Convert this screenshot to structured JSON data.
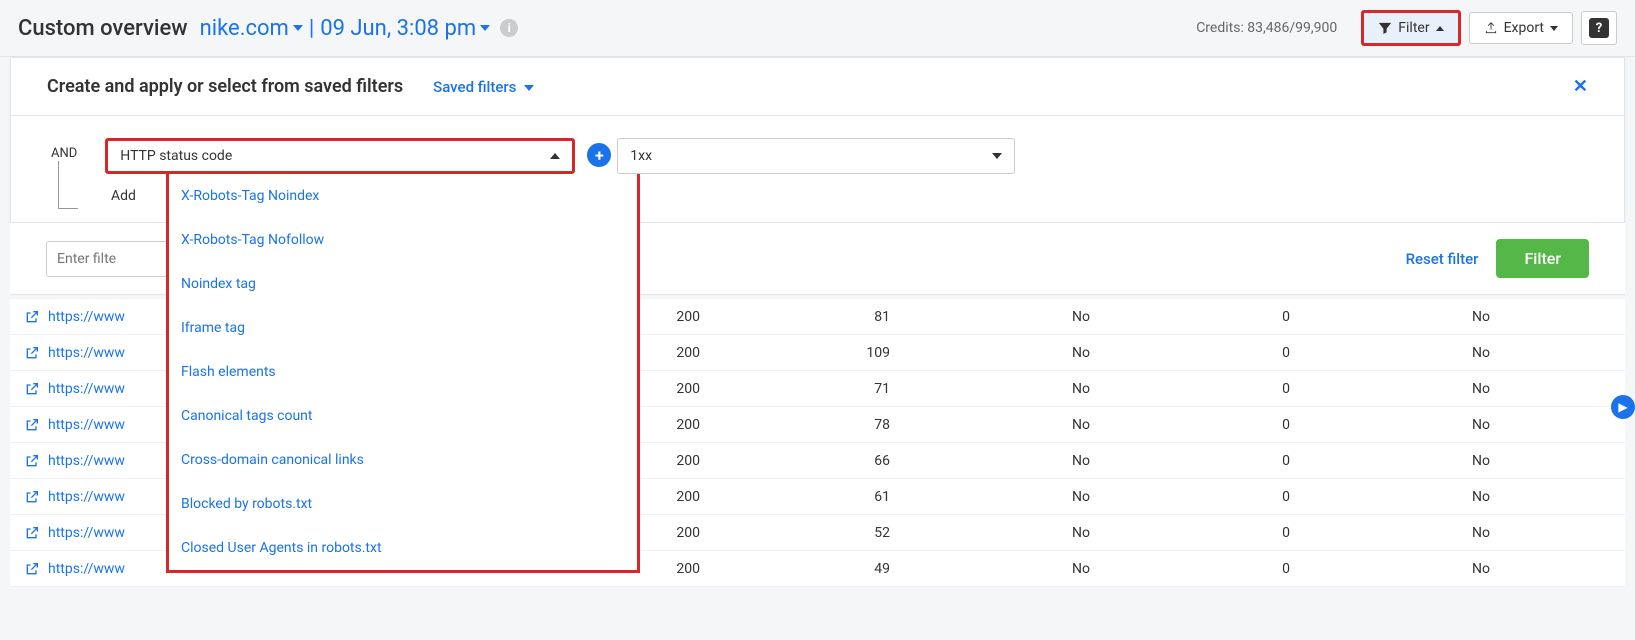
{
  "header": {
    "title": "Custom overview",
    "site": "nike.com",
    "date": "09 Jun, 3:08 pm",
    "credits": "Credits: 83,486/99,900",
    "filter_label": "Filter",
    "export_label": "Export",
    "help": "?"
  },
  "panel": {
    "title": "Create and apply or select from saved filters",
    "saved": "Saved filters",
    "and": "AND",
    "condition_value": "HTTP status code",
    "value_selected": "1xx",
    "add_group": "Add",
    "reset": "Reset filter",
    "apply": "Filter",
    "input_placeholder": "Enter filte"
  },
  "dropdown": {
    "items": [
      "X-Robots-Tag Noindex",
      "X-Robots-Tag Nofollow",
      "Noindex tag",
      "Iframe tag",
      "Flash elements",
      "Canonical tags count",
      "Cross-domain canonical links",
      "Blocked by robots.txt",
      "Closed User Agents in robots.txt"
    ]
  },
  "rows": [
    {
      "url": "https://www",
      "status": "200",
      "v": "81",
      "a": "No",
      "b": "0",
      "c": "No"
    },
    {
      "url": "https://www",
      "status": "200",
      "v": "109",
      "a": "No",
      "b": "0",
      "c": "No"
    },
    {
      "url": "https://www",
      "status": "200",
      "v": "71",
      "a": "No",
      "b": "0",
      "c": "No"
    },
    {
      "url": "https://www",
      "status": "200",
      "v": "78",
      "a": "No",
      "b": "0",
      "c": "No"
    },
    {
      "url": "https://www",
      "status": "200",
      "v": "66",
      "a": "No",
      "b": "0",
      "c": "No"
    },
    {
      "url": "https://www",
      "status": "200",
      "v": "61",
      "a": "No",
      "b": "0",
      "c": "No"
    },
    {
      "url": "https://www",
      "status": "200",
      "v": "52",
      "a": "No",
      "b": "0",
      "c": "No"
    },
    {
      "url": "https://www",
      "status": "200",
      "v": "49",
      "a": "No",
      "b": "0",
      "c": "No"
    }
  ]
}
